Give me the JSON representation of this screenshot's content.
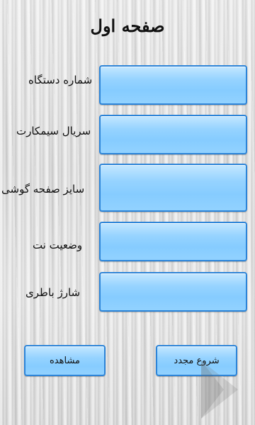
{
  "page": {
    "title": "صفحه اول"
  },
  "rows": [
    {
      "label": "شماره دستگاه",
      "value": ""
    },
    {
      "label": "سریال سیمکارت",
      "value": ""
    },
    {
      "label": "سایز صفحه گوشی",
      "value": ""
    },
    {
      "label": "وضعیت نت",
      "value": ""
    },
    {
      "label": "شارژ باطری",
      "value": ""
    }
  ],
  "buttons": {
    "view_label": "مشاهده",
    "restart_label": "شروع مجدد"
  },
  "colors": {
    "field_border": "#2c84d8",
    "field_fill": "#96d3ff"
  }
}
